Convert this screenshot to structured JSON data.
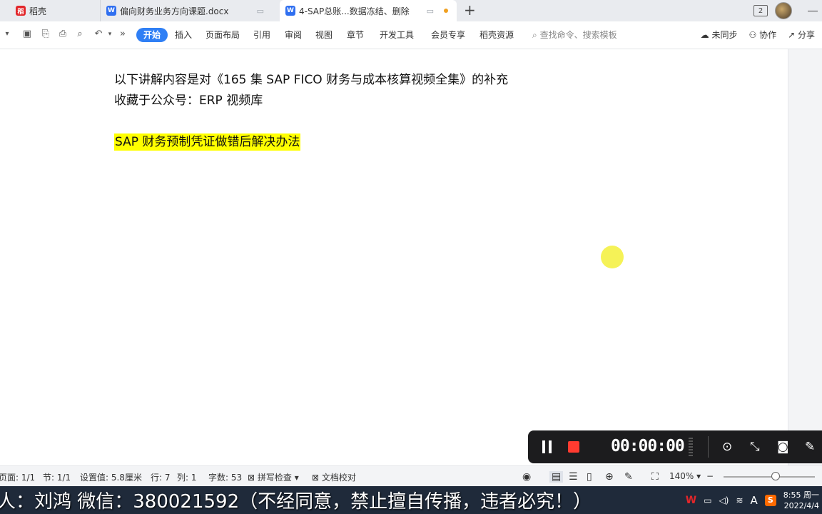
{
  "tabs": [
    {
      "label": "稻壳",
      "icon": "daoke-icon"
    },
    {
      "label": "偏向财务业务方向课题.docx",
      "icon": "wps-doc-icon"
    },
    {
      "label": "4-SAP总账...数据冻结、删除",
      "icon": "wps-doc-icon"
    }
  ],
  "window": {
    "badge": "2"
  },
  "menu": {
    "start": "开始",
    "insert": "插入",
    "layout": "页面布局",
    "ref": "引用",
    "review": "审阅",
    "view": "视图",
    "section": "章节",
    "dev": "开发工具",
    "member": "会员专享",
    "resources": "稻壳资源",
    "search_placeholder": "查找命令、搜索模板",
    "unsynced": "未同步",
    "collab": "协作",
    "share": "分享"
  },
  "document": {
    "line1": "以下讲解内容是对《165 集 SAP FICO 财务与成本核算视频全集》的补充",
    "line2": "收藏于公众号：ERP 视频库",
    "line3": "SAP 财务预制凭证做错后解决办法"
  },
  "recorder": {
    "time": "00:00:00"
  },
  "status": {
    "page": "页面: 1/1",
    "section": "节: 1/1",
    "setting": "设置值: 5.8厘米",
    "row": "行: 7",
    "col": "列: 1",
    "words": "字数: 53",
    "spell": "拼写检查",
    "proof": "文档校对",
    "zoom": "140%"
  },
  "overlay": {
    "text": "人：刘鸿   微信：380021592（不经同意，禁止擅自传播，违者必究！）"
  },
  "tray": {
    "ime": "A",
    "time": "8:55 周一",
    "date": "2022/4/4"
  },
  "colors": {
    "accent": "#2f7ff5",
    "highlight": "#ffff00",
    "record": "#ff3b30"
  }
}
